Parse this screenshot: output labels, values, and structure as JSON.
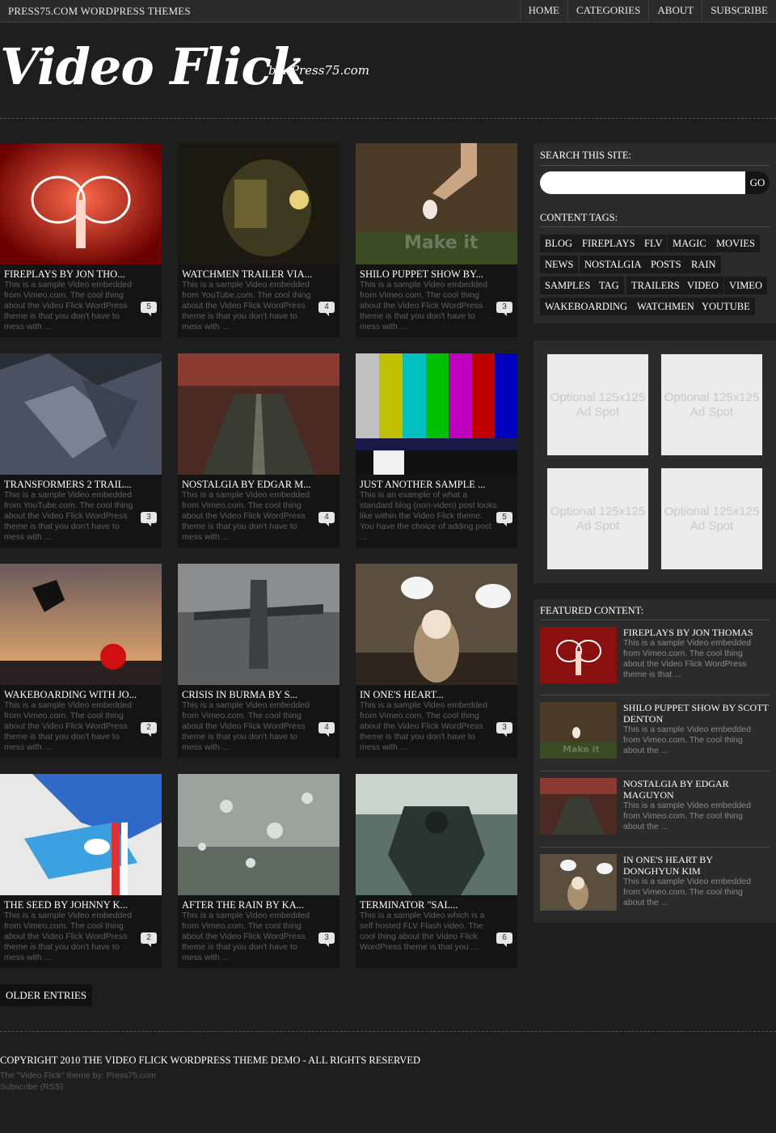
{
  "topbar": {
    "site_name": "PRESS75.COM WORDPRESS THEMES",
    "nav": [
      "HOME",
      "CATEGORIES",
      "ABOUT",
      "SUBSCRIBE"
    ]
  },
  "logo": {
    "title": "Video Flick",
    "byline": "by: Press75.com"
  },
  "posts": [
    {
      "title": "FIREPLAYS BY JON THO...",
      "excerpt": "This is a sample Video embedded from Vimeo.com. The cool thing about the Video Flick WordPress theme is that you don't have to mess with ...",
      "comments": "5"
    },
    {
      "title": "WATCHMEN TRAILER VIA...",
      "excerpt": "This is a sample Video embedded from YouTube.com. The cool thing about the Video Flick WordPress theme is that you don't have to mess with ...",
      "comments": "4"
    },
    {
      "title": "SHILO PUPPET SHOW BY...",
      "excerpt": "This is a sample Video embedded from Vimeo.com. The cool thing about the Video Flick WordPress theme is that you don't have to mess with ...",
      "comments": "3"
    },
    {
      "title": "TRANSFORMERS 2 TRAIL...",
      "excerpt": "This is a sample Video embedded from YouTube.com. The cool thing about the Video Flick WordPress theme is that you don't have to mess with ...",
      "comments": "3"
    },
    {
      "title": "NOSTALGIA BY EDGAR M...",
      "excerpt": "This is a sample Video embedded from Vimeo.com. The cool thing about the Video Flick WordPress theme is that you don't have to mess with ...",
      "comments": "4"
    },
    {
      "title": "JUST ANOTHER SAMPLE ...",
      "excerpt": "This is an example of what a standard blog (non-video) post looks like within the Video Flick theme. You have the choice of adding post ...",
      "comments": "5"
    },
    {
      "title": "WAKEBOARDING WITH JO...",
      "excerpt": "This is a sample Video embedded from Vimeo.com. The cool thing about the Video Flick WordPress theme is that you don't have to mess with ...",
      "comments": "2"
    },
    {
      "title": "CRISIS IN BURMA BY S...",
      "excerpt": "This is a sample Video embedded from Vimeo.com. The cool thing about the Video Flick WordPress theme is that you don't have to mess with ...",
      "comments": "4"
    },
    {
      "title": "IN ONE'S HEART...",
      "excerpt": "This is a sample Video embedded from Vimeo.com. The cool thing about the Video Flick WordPress theme is that you don't have to mess with ...",
      "comments": "3"
    },
    {
      "title": "THE SEED BY JOHNNY K...",
      "excerpt": "This is a sample Video embedded from Vimeo.com. The cool thing about the Video Flick WordPress theme is that you don't have to mess with ...",
      "comments": "2"
    },
    {
      "title": "AFTER THE RAIN BY KA...",
      "excerpt": "This is a sample Video embedded from Vimeo.com. The cool thing about the Video Flick WordPress theme is that you don't have to mess with ...",
      "comments": "3"
    },
    {
      "title": "TERMINATOR \"SAL...",
      "excerpt": "This is a sample Video which is a self hosted FLV Flash video. The cool thing about the Video Flick WordPress theme is that you ...",
      "comments": "6"
    }
  ],
  "older_entries": "OLDER ENTRIES",
  "sidebar": {
    "search_heading": "SEARCH THIS SITE:",
    "search_placeholder": "",
    "search_button": "GO",
    "tags_heading": "CONTENT TAGS:",
    "tags": [
      "BLOG",
      "FIREPLAYS",
      "FLV",
      "MAGIC",
      "MOVIES",
      "NEWS",
      "NOSTALGIA",
      "POSTS",
      "RAIN",
      "SAMPLES",
      "TAG",
      "TRAILERS",
      "VIDEO",
      "VIMEO",
      "WAKEBOARDING",
      "WATCHMEN",
      "YOUTUBE"
    ],
    "ad_text": "Optional 125x125 Ad Spot",
    "featured_heading": "FEATURED CONTENT:",
    "featured": [
      {
        "title": "FIREPLAYS BY JON THOMAS",
        "excerpt": "This is a sample Video embedded from Vimeo.com. The cool thing about the Video Flick WordPress theme is that ..."
      },
      {
        "title": "SHILO PUPPET SHOW BY SCOTT DENTON",
        "excerpt": "This is a sample Video embedded from Vimeo.com. The cool thing about the ..."
      },
      {
        "title": "NOSTALGIA BY EDGAR MAGUYON",
        "excerpt": "This is a sample Video embedded from Vimeo.com. The cool thing about the ..."
      },
      {
        "title": "IN ONE'S HEART BY DONGHYUN KIM",
        "excerpt": "This is a sample Video embedded from Vimeo.com. The cool thing about the ..."
      }
    ]
  },
  "footer": {
    "copyright": "COPYRIGHT 2010 THE VIDEO FLICK WORDPRESS THEME DEMO - ALL RIGHTS RESERVED",
    "credit": "The \"Video Flick\" theme by: Press75.com",
    "rss": "Subscribe (RSS)"
  }
}
